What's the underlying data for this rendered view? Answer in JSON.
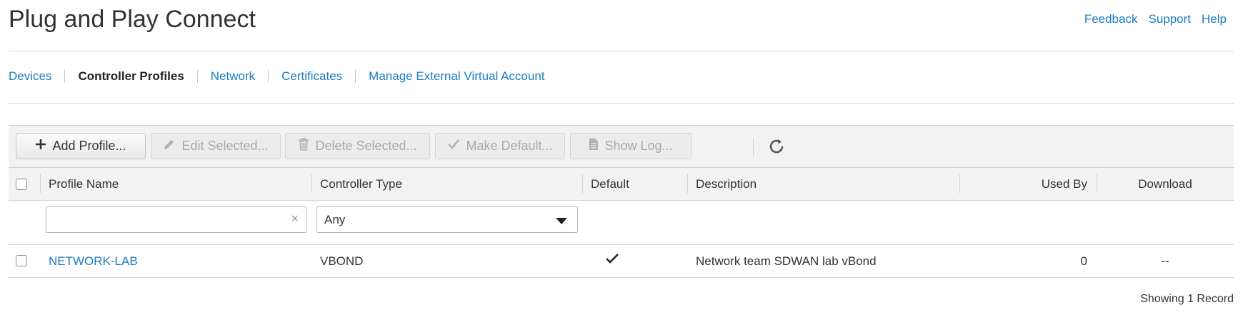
{
  "app": {
    "title": "Plug and Play Connect"
  },
  "top_links": [
    {
      "label": "Feedback",
      "name": "feedback-link"
    },
    {
      "label": "Support",
      "name": "support-link"
    },
    {
      "label": "Help",
      "name": "help-link"
    }
  ],
  "tabs": [
    {
      "label": "Devices",
      "active": false
    },
    {
      "label": "Controller Profiles",
      "active": true
    },
    {
      "label": "Network",
      "active": false
    },
    {
      "label": "Certificates",
      "active": false
    },
    {
      "label": "Manage External Virtual Account",
      "active": false
    }
  ],
  "toolbar": {
    "add_label": "Add Profile...",
    "edit_label": "Edit Selected...",
    "delete_label": "Delete Selected...",
    "make_default_label": "Make Default...",
    "show_log_label": "Show Log..."
  },
  "table": {
    "columns": {
      "profile_name": "Profile Name",
      "controller_type": "Controller Type",
      "default": "Default",
      "description": "Description",
      "used_by": "Used By",
      "download": "Download"
    },
    "filters": {
      "profile_name_value": "",
      "controller_type_value": "Any",
      "controller_type_clear": "×"
    },
    "rows": [
      {
        "profile_name": "NETWORK-LAB",
        "controller_type": "VBOND",
        "is_default": true,
        "description": "Network team SDWAN lab vBond",
        "used_by": "0",
        "download": "--"
      }
    ]
  },
  "footer": {
    "record_count": "Showing 1 Record"
  },
  "colors": {
    "link": "#1a7dc1",
    "toolbar_bg": "#f2f2f2",
    "border": "#d6d6d6"
  },
  "icons": {
    "add": "plus-icon",
    "edit": "pencil-icon",
    "delete": "trash-icon",
    "make_default": "checkmark-icon",
    "show_log": "document-icon",
    "refresh": "refresh-icon",
    "clear": "clear-x-icon",
    "select": "caret-down-icon",
    "default_mark": "checkmark-icon"
  }
}
